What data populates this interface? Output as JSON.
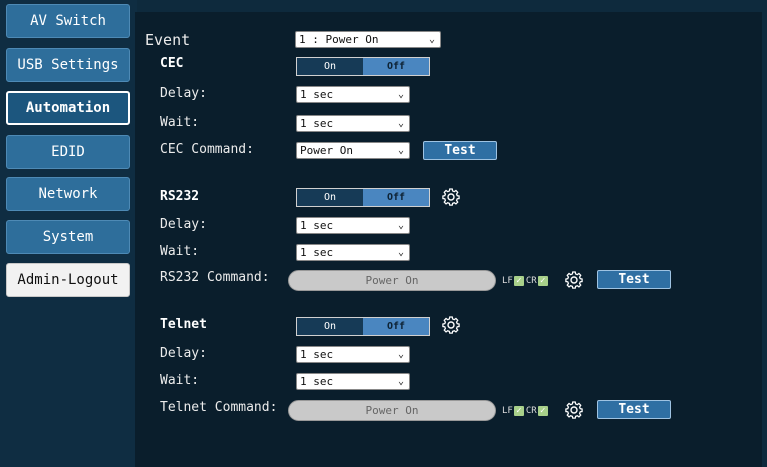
{
  "sidebar": {
    "items": [
      {
        "label": "AV Switch"
      },
      {
        "label": "USB Settings"
      },
      {
        "label": "Automation",
        "active": true
      },
      {
        "label": "EDID"
      },
      {
        "label": "Network"
      },
      {
        "label": "System"
      },
      {
        "label": "Admin-Logout"
      }
    ]
  },
  "event": {
    "label": "Event",
    "value": "1 : Power On"
  },
  "cec": {
    "title": "CEC",
    "toggle": {
      "on": "On",
      "off": "Off",
      "selected": "Off"
    },
    "delay": {
      "label": "Delay:",
      "value": "1 sec"
    },
    "wait": {
      "label": "Wait:",
      "value": "1 sec"
    },
    "command": {
      "label": "CEC Command:",
      "value": "Power On"
    },
    "test_label": "Test"
  },
  "rs232": {
    "title": "RS232",
    "toggle": {
      "on": "On",
      "off": "Off",
      "selected": "Off"
    },
    "delay": {
      "label": "Delay:",
      "value": "1 sec"
    },
    "wait": {
      "label": "Wait:",
      "value": "1 sec"
    },
    "command": {
      "label": "RS232 Command:",
      "value": "Power On"
    },
    "lf": {
      "label": "LF",
      "checked": true
    },
    "cr": {
      "label": "CR",
      "checked": true
    },
    "test_label": "Test"
  },
  "telnet": {
    "title": "Telnet",
    "toggle": {
      "on": "On",
      "off": "Off",
      "selected": "Off"
    },
    "delay": {
      "label": "Delay:",
      "value": "1 sec"
    },
    "wait": {
      "label": "Wait:",
      "value": "1 sec"
    },
    "command": {
      "label": "Telnet Command:",
      "value": "Power On"
    },
    "lf": {
      "label": "LF",
      "checked": true
    },
    "cr": {
      "label": "CR",
      "checked": true
    },
    "test_label": "Test"
  },
  "colors": {
    "accent": "#2f6fa3",
    "background": "#0a1e2c",
    "sidebar": "#0f2d42",
    "toggle_off_active": "#4a86c0"
  },
  "icons": {
    "gear": "gear-icon",
    "chevron": "chevron-down-icon",
    "check": "checkmark-icon"
  }
}
